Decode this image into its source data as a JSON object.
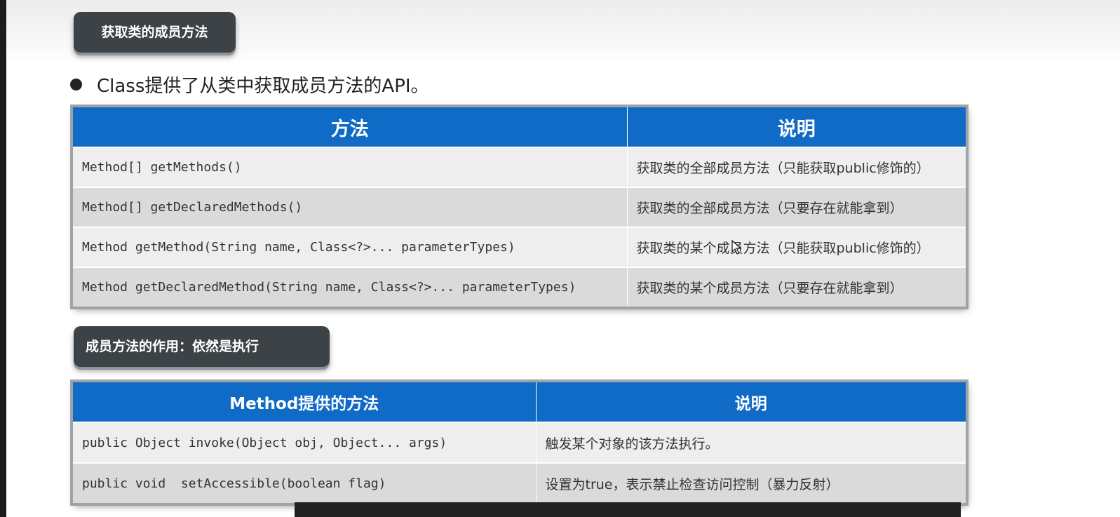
{
  "section1": {
    "pill_label": "获取类的成员方法"
  },
  "bullet": {
    "text": "Class提供了从类中获取成员方法的API。"
  },
  "table1": {
    "headers": [
      "方法",
      "说明"
    ],
    "rows": [
      [
        "Method[] getMethods()",
        "获取类的全部成员方法（只能获取public修饰的）"
      ],
      [
        "Method[] getDeclaredMethods()",
        "获取类的全部成员方法（只要存在就能拿到）"
      ],
      [
        "Method getMethod(String name, Class<?>... parameterTypes)",
        "获取类的某个成员方法（只能获取public修饰的）"
      ],
      [
        "Method getDeclaredMethod(String name, Class<?>... parameterTypes)",
        "获取类的某个成员方法（只要存在就能拿到）"
      ]
    ]
  },
  "section2": {
    "pill_label": "成员方法的作用：依然是执行"
  },
  "table2": {
    "headers": [
      "Method提供的方法",
      "说明"
    ],
    "rows": [
      [
        "public Object invoke(Object obj, Object... args)",
        "触发某个对象的该方法执行。"
      ],
      [
        "public void  setAccessible(boolean flag)",
        "设置为true，表示禁止检查访问控制（暴力反射）"
      ]
    ]
  },
  "colors": {
    "header_blue": "#0f6bc6",
    "pill_dark": "#3c4245",
    "row_light": "#eeeeee",
    "row_dark": "#dadada"
  },
  "icons": {
    "bullet": "bullet-dot-icon",
    "cursor": "mouse-cursor-icon"
  }
}
